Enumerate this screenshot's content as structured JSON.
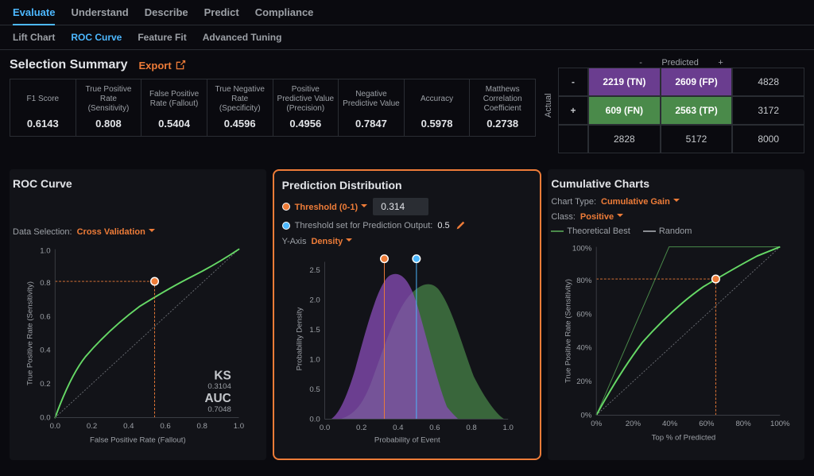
{
  "topTabs": [
    "Evaluate",
    "Understand",
    "Describe",
    "Predict",
    "Compliance"
  ],
  "subTabs": [
    "Lift Chart",
    "ROC Curve",
    "Feature Fit",
    "Advanced Tuning"
  ],
  "selection": {
    "title": "Selection Summary",
    "export": "Export",
    "metrics": [
      {
        "label": "F1 Score",
        "value": "0.6143"
      },
      {
        "label": "True Positive Rate (Sensitivity)",
        "value": "0.808"
      },
      {
        "label": "False Positive Rate (Fallout)",
        "value": "0.5404"
      },
      {
        "label": "True Negative Rate (Specificity)",
        "value": "0.4596"
      },
      {
        "label": "Positive Predictive Value (Precision)",
        "value": "0.4956"
      },
      {
        "label": "Negative Predictive Value",
        "value": "0.7847"
      },
      {
        "label": "Accuracy",
        "value": "0.5978"
      },
      {
        "label": "Matthews Correlation Coefficient",
        "value": "0.2738"
      }
    ]
  },
  "confusion": {
    "predicted": "Predicted",
    "actual": "Actual",
    "minus": "-",
    "plus": "+",
    "tn": "2219 (TN)",
    "fp": "2609 (FP)",
    "fn": "609 (FN)",
    "tp": "2563 (TP)",
    "rowNeg": "4828",
    "rowPos": "3172",
    "colNeg": "2828",
    "colPos": "5172",
    "total": "8000"
  },
  "roc": {
    "title": "ROC Curve",
    "dataSel": "Data Selection:",
    "dataSelVal": "Cross Validation",
    "xlabel": "False Positive Rate (Fallout)",
    "ylabel": "True Positive Rate (Sensitivity)",
    "ks": "KS",
    "ksVal": "0.3104",
    "auc": "AUC",
    "aucVal": "0.7048",
    "pointX": 0.54,
    "pointY": 0.808
  },
  "dist": {
    "title": "Prediction Distribution",
    "threshLabel": "Threshold (0-1)",
    "threshVal": "0.314",
    "outLabel": "Threshold set for Prediction Output:",
    "outVal": "0.5",
    "yaxisLbl": "Y-Axis",
    "yaxisVal": "Density",
    "xlabel": "Probability of Event",
    "ylabel": "Probability Density"
  },
  "cum": {
    "title": "Cumulative Charts",
    "typeLabel": "Chart Type:",
    "typeVal": "Cumulative Gain",
    "classLabel": "Class:",
    "classVal": "Positive",
    "legendBest": "Theoretical Best",
    "legendRand": "Random",
    "xlabel": "Top % of Predicted",
    "ylabel": "True Positive Rate (Sensitivity)",
    "pointX": 0.65,
    "pointY": 0.808
  },
  "chart_data": [
    {
      "type": "line",
      "name": "roc",
      "xlabel": "False Positive Rate (Fallout)",
      "ylabel": "True Positive Rate (Sensitivity)",
      "xlim": [
        0,
        1
      ],
      "ylim": [
        0,
        1
      ],
      "series": [
        {
          "name": "ROC",
          "x": [
            0,
            0.05,
            0.1,
            0.2,
            0.3,
            0.4,
            0.5,
            0.54,
            0.6,
            0.7,
            0.8,
            0.9,
            1.0
          ],
          "y": [
            0,
            0.22,
            0.36,
            0.52,
            0.64,
            0.73,
            0.79,
            0.808,
            0.85,
            0.91,
            0.95,
            0.98,
            1.0
          ]
        }
      ],
      "annotations": {
        "KS": 0.3104,
        "AUC": 0.7048
      },
      "marker": {
        "x": 0.54,
        "y": 0.808
      }
    },
    {
      "type": "area",
      "name": "prediction_distribution",
      "xlabel": "Probability of Event",
      "ylabel": "Probability Density",
      "xlim": [
        0,
        1
      ],
      "ylim": [
        0,
        2.8
      ],
      "series": [
        {
          "name": "negative",
          "color": "#8a4db8",
          "x": [
            0.05,
            0.1,
            0.15,
            0.2,
            0.25,
            0.3,
            0.35,
            0.4,
            0.45,
            0.5,
            0.55,
            0.6,
            0.65,
            0.7
          ],
          "y": [
            0.1,
            0.35,
            0.8,
            1.4,
            2.1,
            2.65,
            2.5,
            2.05,
            1.55,
            1.05,
            0.6,
            0.3,
            0.12,
            0.02
          ]
        },
        {
          "name": "positive",
          "color": "#4a8a4a",
          "x": [
            0.1,
            0.15,
            0.2,
            0.25,
            0.3,
            0.35,
            0.4,
            0.45,
            0.5,
            0.55,
            0.6,
            0.65,
            0.7,
            0.75,
            0.8,
            0.85,
            0.9,
            0.95
          ],
          "y": [
            0.02,
            0.1,
            0.3,
            0.55,
            0.9,
            1.3,
            1.7,
            2.05,
            2.25,
            2.1,
            1.8,
            1.45,
            1.05,
            0.7,
            0.42,
            0.22,
            0.1,
            0.02
          ]
        }
      ],
      "thresholds": [
        0.314,
        0.5
      ]
    },
    {
      "type": "line",
      "name": "cumulative_gain",
      "xlabel": "Top % of Predicted",
      "ylabel": "True Positive Rate (Sensitivity)",
      "xlim": [
        0,
        100
      ],
      "ylim": [
        0,
        100
      ],
      "series": [
        {
          "name": "Model",
          "x": [
            0,
            5,
            10,
            20,
            30,
            40,
            50,
            60,
            65,
            70,
            80,
            90,
            100
          ],
          "y": [
            0,
            12,
            22,
            40,
            53,
            64,
            72,
            78,
            80.8,
            85,
            92,
            97,
            100
          ]
        },
        {
          "name": "Theoretical Best",
          "x": [
            0,
            40,
            100
          ],
          "y": [
            0,
            100,
            100
          ]
        },
        {
          "name": "Random",
          "x": [
            0,
            100
          ],
          "y": [
            0,
            100
          ]
        }
      ],
      "marker": {
        "x": 65,
        "y": 80.8
      }
    }
  ]
}
